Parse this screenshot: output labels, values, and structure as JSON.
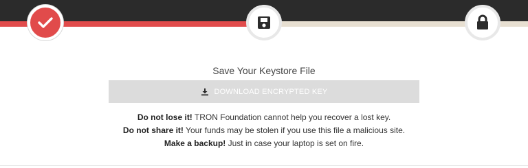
{
  "steps": {
    "progress_fraction": 0.5,
    "items": [
      {
        "name": "created",
        "icon": "checkmark-icon",
        "state": "done"
      },
      {
        "name": "save-keystore",
        "icon": "floppy-disk-icon",
        "state": "current"
      },
      {
        "name": "secured",
        "icon": "lock-icon",
        "state": "future"
      }
    ]
  },
  "main": {
    "title": "Save Your Keystore File",
    "download_button": {
      "label": "DOWNLOAD ENCRYPTED KEY",
      "icon": "download-icon"
    },
    "notes": [
      {
        "bold": "Do not lose it!",
        "text": " TRON Foundation cannot help you recover a lost key."
      },
      {
        "bold": "Do not share it!",
        "text": " Your funds may be stolen if you use this file a malicious site."
      },
      {
        "bold": "Make a backup!",
        "text": " Just in case your laptop is set on fire."
      }
    ]
  },
  "colors": {
    "accent_red": "#e14b4b",
    "top_bar": "#2b2b2b",
    "track": "#e7dfd1",
    "button_disabled": "#dcdcdc"
  }
}
